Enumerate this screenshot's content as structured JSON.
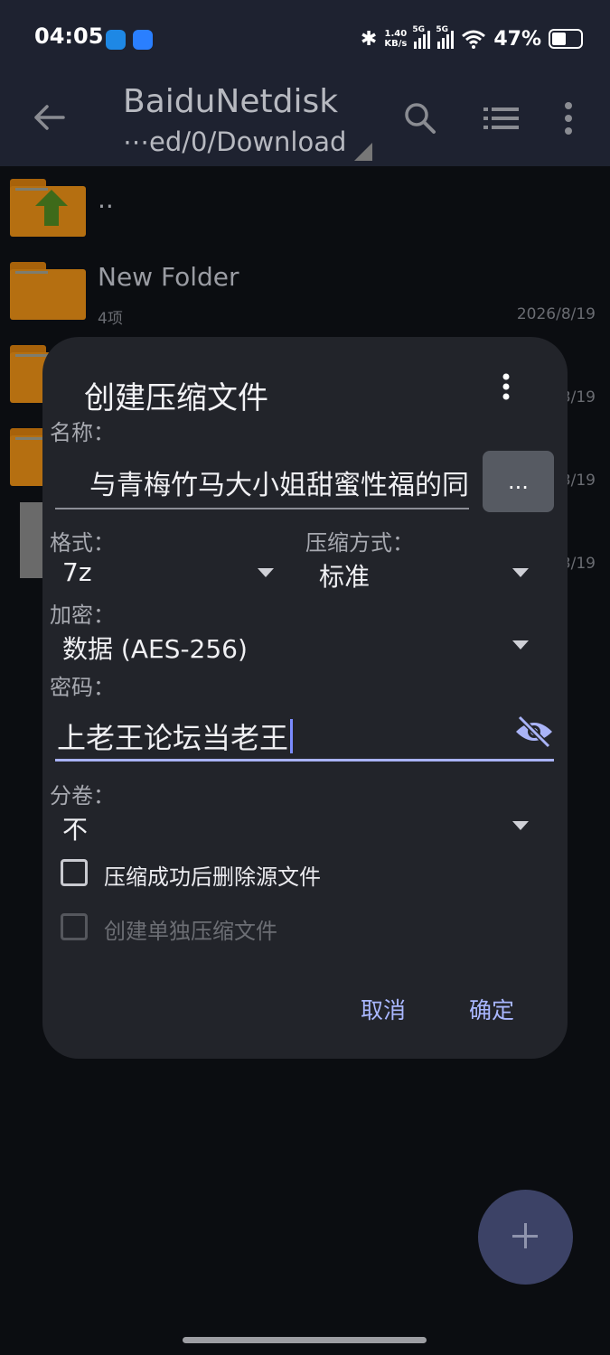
{
  "status": {
    "time": "04:05",
    "speed_top": "1.40",
    "speed_unit": "KB/s",
    "sig1": "5G",
    "sig2": "5G",
    "battery": "47%"
  },
  "appbar": {
    "title": "BaiduNetdisk",
    "path": "⋯ed/0/Download"
  },
  "files": [
    {
      "name": "..",
      "meta": "",
      "date": ""
    },
    {
      "name": "New Folder",
      "meta": "4项",
      "date": "2026/8/19"
    }
  ],
  "hidden_dates": [
    "3/19",
    "3/19",
    "3/19"
  ],
  "dialog": {
    "title": "创建压缩文件",
    "name_label": "名称：",
    "name_value": "与青梅竹马大小姐甜蜜性福的同",
    "browse_label": "...",
    "format_label": "格式：",
    "format_value": "7z",
    "method_label": "压缩方式：",
    "method_value": "标准",
    "encrypt_label": "加密：",
    "encrypt_value": "数据 (AES-256)",
    "password_label": "密码：",
    "password_value": "上老王论坛当老王",
    "volume_label": "分卷：",
    "volume_value": "不",
    "delete_source_label": "压缩成功后删除源文件",
    "separate_label": "创建单独压缩文件",
    "cancel_label": "取消",
    "ok_label": "确定"
  },
  "colors": {
    "accent": "#a9b7ff",
    "dialog_bg": "#22242a",
    "folder": "#b56f11"
  }
}
